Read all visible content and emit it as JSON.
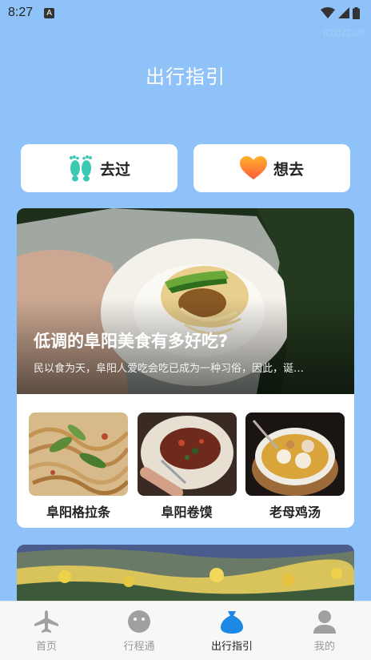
{
  "status_bar": {
    "time": "8:27",
    "notification_badge": "A",
    "icons": [
      "wifi-icon",
      "signal-icon",
      "battery-icon"
    ]
  },
  "id_label": "ID:022a3f",
  "page_title": "出行指引",
  "buttons": {
    "been": {
      "label": "去过",
      "icon": "footprints-icon"
    },
    "want": {
      "label": "想去",
      "icon": "heart-icon"
    }
  },
  "feature_card": {
    "title": "低调的阜阳美食有多好吃?",
    "subtitle": "民以食为天，阜阳人爱吃会吃已成为一种习俗，因此，诞…",
    "dishes": [
      {
        "name": "阜阳格拉条"
      },
      {
        "name": "阜阳卷馍"
      },
      {
        "name": "老母鸡汤"
      }
    ]
  },
  "tabbar": {
    "items": [
      {
        "label": "首页",
        "icon": "airplane-icon"
      },
      {
        "label": "行程通",
        "icon": "chat-face-icon"
      },
      {
        "label": "出行指引",
        "icon": "money-bag-icon"
      },
      {
        "label": "我的",
        "icon": "person-icon"
      }
    ],
    "active_index": 2
  },
  "colors": {
    "background": "#8ec2f8",
    "active_tab": "#1e88e5",
    "inactive_tab": "#999999"
  }
}
